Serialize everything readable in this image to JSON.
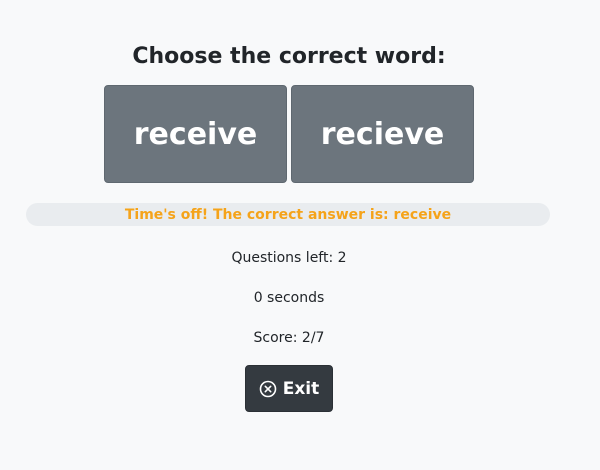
{
  "prompt": {
    "title": "Choose the correct word:"
  },
  "options": [
    {
      "label": "receive"
    },
    {
      "label": "recieve"
    }
  ],
  "feedback": {
    "message": "Time's off! The correct answer is: receive",
    "color": "#f5a31a"
  },
  "stats": {
    "questions_left": "Questions left: 2",
    "seconds": "0 seconds",
    "score": "Score: 2/7"
  },
  "exit_button": {
    "label": "Exit",
    "icon": "close-circle-icon"
  }
}
